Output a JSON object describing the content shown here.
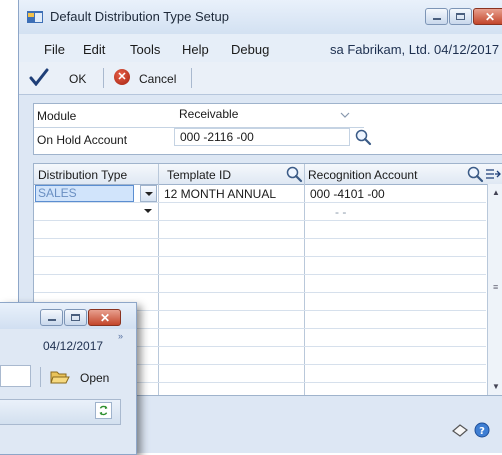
{
  "window": {
    "title": "Default Distribution Type Setup"
  },
  "menubar": {
    "items": [
      "File",
      "Edit",
      "Tools",
      "Help",
      "Debug"
    ],
    "user_company_date": "sa  Fabrikam, Ltd.  04/12/2017"
  },
  "toolbar": {
    "ok_label": "OK",
    "cancel_label": "Cancel"
  },
  "form": {
    "module_label": "Module",
    "module_value": "Receivable",
    "on_hold_label": "On Hold Account",
    "on_hold_value": "000 -2116 -00"
  },
  "grid": {
    "columns": [
      "Distribution Type",
      "Template ID",
      "Recognition Account"
    ],
    "rows": [
      {
        "distribution_type": "SALES",
        "template_id": "12 MONTH ANNUAL",
        "recognition_account": "000 -4101 -00"
      },
      {
        "distribution_type": "",
        "template_id": "",
        "recognition_account": "-        -"
      }
    ]
  },
  "second_window": {
    "date": "04/12/2017",
    "open_label": "Open"
  }
}
